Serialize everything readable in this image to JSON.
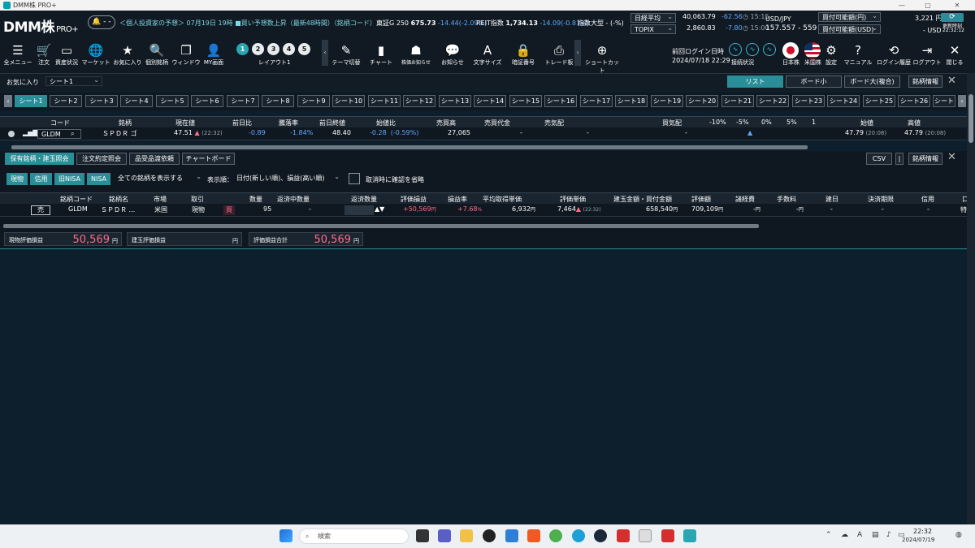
{
  "window": {
    "title": "DMM株 PRO+",
    "minimize": "—",
    "restore": "▢",
    "close": "✕"
  },
  "header": {
    "brand_main": "DMM株",
    "brand_sub": "PRO+",
    "bell_label": "- -",
    "ticker": "＜個人投資家の予想＞ 07月19日 19時 ■買い予想数上昇（最新48時間）（銘柄コード）...",
    "tse_growth": {
      "label": "東証G 250",
      "value": "675.73",
      "change": "-14.44(-2.09%)"
    },
    "reit": {
      "label": "REIT指数",
      "value": "1,734.13",
      "change": "-14.09(-0.81%)"
    },
    "size_idx": {
      "label": "指数大型",
      "value": "- (-%)"
    },
    "nikkei": {
      "label": "日経平均",
      "value": "40,063.79",
      "change": "-62.56",
      "time": "15:15"
    },
    "topix": {
      "label": "TOPIX",
      "value": "2,860.83",
      "change": "-7.80",
      "time": "15:00"
    },
    "fx": {
      "label": "USD/JPY",
      "value": "157.557 - 559"
    },
    "buying_power_jpy": "買付可能額(円)",
    "buying_power_usd": "買付可能額(USD)",
    "amount_jpy": "3,221 円",
    "amount_usd": "- USD",
    "update_time_label": "更新時刻",
    "update_time": "22:32:12",
    "last_login_label": "前回ログイン日時",
    "last_login": "2024/07/18 22:29"
  },
  "toolbar": {
    "items": [
      {
        "name": "all-menu",
        "icon": "☰",
        "label": "全メニュー"
      },
      {
        "name": "order",
        "icon": "🛒",
        "label": "注文"
      },
      {
        "name": "assets",
        "icon": "▭",
        "label": "資産状況"
      },
      {
        "name": "market",
        "icon": "🌐",
        "label": "マーケット"
      },
      {
        "name": "favorites",
        "icon": "★",
        "label": "お気に入り"
      },
      {
        "name": "stock-detail",
        "icon": "🔍",
        "label": "個別銘柄"
      },
      {
        "name": "window",
        "icon": "❐",
        "label": "ウィンドウ"
      },
      {
        "name": "my-screen",
        "icon": "👤",
        "label": "MY画面"
      }
    ],
    "layouts": [
      "1",
      "2",
      "3",
      "4",
      "5"
    ],
    "layout_label": "レイアウト1",
    "items2": [
      {
        "name": "theme-switch",
        "icon": "✎",
        "label": "テーマ切替"
      },
      {
        "name": "chart",
        "icon": "▮",
        "label": "チャート"
      },
      {
        "name": "stock-news",
        "icon": "☗",
        "label": "株価お知らせ"
      },
      {
        "name": "notice",
        "icon": "💬",
        "label": "お知らせ"
      },
      {
        "name": "font-size",
        "icon": "A",
        "label": "文字サイズ"
      },
      {
        "name": "pin",
        "icon": "🔒",
        "label": "暗証番号"
      },
      {
        "name": "trade-board",
        "icon": "⎙",
        "label": "トレード板"
      },
      {
        "name": "shortcut",
        "icon": "⊕",
        "label": "ショートカット"
      }
    ],
    "conn_label": "接続状況",
    "right_items": [
      {
        "name": "jp-stock",
        "label": "日本株"
      },
      {
        "name": "us-stock",
        "label": "米国株"
      },
      {
        "name": "settings",
        "icon": "⚙",
        "label": "設定"
      },
      {
        "name": "manual",
        "icon": "?",
        "label": "マニュアル"
      },
      {
        "name": "login-history",
        "icon": "⟲",
        "label": "ログイン履歴"
      },
      {
        "name": "logout",
        "icon": "⇥",
        "label": "ログアウト"
      },
      {
        "name": "close",
        "icon": "✕",
        "label": "閉じる"
      }
    ]
  },
  "favorites": {
    "label": "お気に入り",
    "sheet": "シート1",
    "views": [
      "リスト",
      "ボード小",
      "ボード大(複合)"
    ],
    "info": "銘柄情報"
  },
  "sheets": [
    "シート1",
    "シート2",
    "シート3",
    "シート4",
    "シート5",
    "シート6",
    "シート7",
    "シート8",
    "シート9",
    "シート10",
    "シート11",
    "シート12",
    "シート13",
    "シート14",
    "シート15",
    "シート16",
    "シート17",
    "シート18",
    "シート19",
    "シート20",
    "シート21",
    "シート22",
    "シート23",
    "シート24",
    "シート25",
    "シート26",
    "シート"
  ],
  "quote": {
    "headers": [
      "コード",
      "銘柄",
      "現在値",
      "前日比",
      "騰落率",
      "前日終値",
      "始値比",
      "売買高",
      "売買代金",
      "売気配",
      "買気配",
      "-10%",
      "-5%",
      "0%",
      "5%",
      "1",
      "始値",
      "高値"
    ],
    "row": {
      "code": "GLDM",
      "name": "ＳＰＤＲ ゴ",
      "price": "47.51",
      "price_time": "(22:32)",
      "change": "-0.89",
      "pct": "-1.84%",
      "prev_close": "48.40",
      "open_change": "-0.28",
      "open_change_pct": "(-0.59%)",
      "volume": "27,065",
      "turnover": "-",
      "ask": "-",
      "bid": "-",
      "open": "47.79",
      "open_time": "(20:08)",
      "high": "47.79",
      "high_time": "(20:08)"
    }
  },
  "holdings": {
    "tabs": [
      "保有銘柄・建玉照会",
      "注文約定照会",
      "品受品渡依頼",
      "チャートボード"
    ],
    "csv": "CSV",
    "info": "銘柄情報",
    "filters": [
      "現物",
      "信用",
      "旧NISA",
      "NISA"
    ],
    "show_select": "全ての銘柄を表示する",
    "order_label": "表示順：",
    "order_select": "日付(新しい順)、損益(高い順)",
    "confirm_label": "取消時に確認を省略",
    "headers": [
      "銘柄コード",
      "銘柄名",
      "市場",
      "取引",
      "",
      "数量",
      "返済中数量",
      "返済数量",
      "評価損益",
      "損益率",
      "平均取得単価",
      "評価単価",
      "建玉金額・買付金額",
      "評価額",
      "諸経費",
      "手数料",
      "建日",
      "決済期限",
      "信用",
      "口"
    ],
    "row": {
      "sell_btn": "売",
      "code": "GLDM",
      "name": "ＳＰＤＲ ...",
      "market": "米国",
      "trade": "現物",
      "side": "買",
      "qty": "95",
      "returning": "-",
      "return_qty": "",
      "pnl": "+50,569",
      "pnl_unit": "円",
      "rate": "+7.68",
      "rate_unit": "%",
      "avg_cost": "6,932",
      "avg_unit": "円",
      "eval_price": "7,464",
      "eval_time": "(22:32)",
      "amount": "658,540",
      "amount_unit": "円",
      "value": "709,109",
      "value_unit": "円",
      "expenses": "-",
      "fee": "-",
      "date": "-",
      "deadline": "-",
      "margin": "-",
      "acct": "特"
    },
    "summary": [
      {
        "label": "現物評価損益",
        "value": "50,569",
        "unit": "円"
      },
      {
        "label": "建玉評価損益",
        "value": "",
        "unit": "円"
      },
      {
        "label": "評価損益合計",
        "value": "50,569",
        "unit": "円"
      }
    ]
  },
  "taskbar": {
    "search": "検索",
    "time": "22:32",
    "date": "2024/07/19",
    "ime": "A"
  },
  "colors": {
    "accent": "#2a8e98",
    "up": "#ff6a8a",
    "down": "#5fa8ff",
    "bg": "#0d1f2d"
  }
}
